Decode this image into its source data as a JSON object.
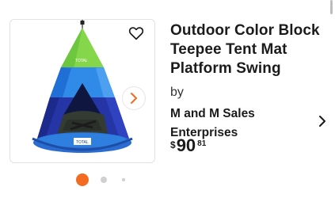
{
  "product": {
    "title": "Outdoor Color Block Teepee Tent Mat Platform Swing",
    "by_label": "by",
    "seller": "M and M Sales Enterprises",
    "price": {
      "currency": "$",
      "whole": "90",
      "cents": "81"
    }
  },
  "gallery": {
    "image_name": "teepee-tent-swing-photo",
    "favorite_icon": "heart-outline-icon",
    "next_icon": "chevron-right-icon",
    "dot_count": 3,
    "active_index": 0
  },
  "colors": {
    "accent_orange": "#f26b21",
    "tent_green": "#7ed957",
    "tent_blue": "#2c7ee6",
    "tent_navy": "#2430a8",
    "dot_inactive": "#cfcfcf"
  }
}
